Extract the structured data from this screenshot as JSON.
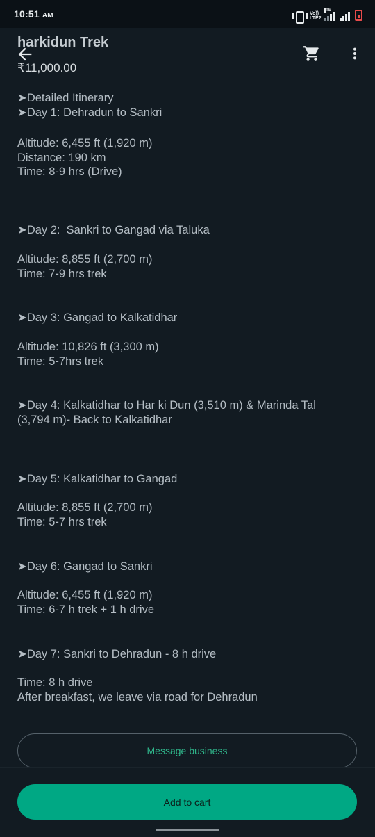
{
  "status_bar": {
    "time": "10:51",
    "ampm": "AM",
    "volte_label": "Vo)) LTE2",
    "lte_label": "LTE"
  },
  "header": {
    "title": "harkidun Trek",
    "price": "₹11,000.00",
    "icons": [
      "back-arrow-icon",
      "cart-icon",
      "more-vert-icon"
    ]
  },
  "itinerary": [
    "➤Detailed Itinerary\n➤Day 1: Dehradun to Sankri",
    "Altitude: 6,455 ft (1,920 m)\nDistance: 190 km\nTime: 8-9 hrs (Drive)",
    "➤Day 2:  Sankri to Gangad via Taluka",
    "Altitude: 8,855 ft (2,700 m)\nTime: 7-9 hrs trek",
    "➤Day 3: Gangad to Kalkatidhar",
    "Altitude: 10,826 ft (3,300 m)\nTime: 5-7hrs trek",
    "➤Day 4: Kalkatidhar to Har ki Dun (3,510 m) & Marinda Tal\n(3,794 m)- Back to Kalkatidhar",
    "➤Day 5: Kalkatidhar to Gangad",
    "Altitude: 8,855 ft (2,700 m)\nTime: 5-7 hrs trek",
    "➤Day 6: Gangad to Sankri",
    "Altitude: 6,455 ft (1,920 m)\nTime: 6-7 h trek + 1 h drive",
    "➤Day 7: Sankri to Dehradun - 8 h drive",
    "Time: 8 h drive\nAfter breakfast, we leave via road for Dehradun"
  ],
  "actions": {
    "message_label": "Message business",
    "add_to_cart_label": "Add to cart"
  },
  "colors": {
    "background": "#121b22",
    "accent": "#00a884",
    "accent_text": "#2fb58a"
  }
}
